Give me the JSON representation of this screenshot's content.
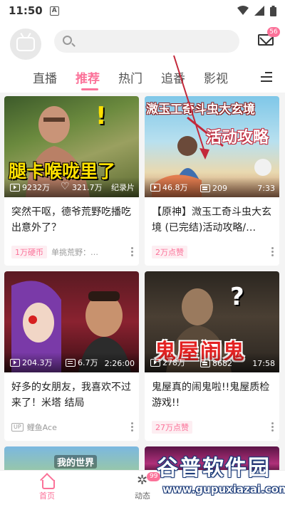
{
  "status_bar": {
    "time": "11:50",
    "a_icon_label": "A"
  },
  "header": {
    "search_placeholder": "",
    "mail_badge": "56"
  },
  "tabs": [
    {
      "label": "直播",
      "active": false
    },
    {
      "label": "推荐",
      "active": true
    },
    {
      "label": "热门",
      "active": false
    },
    {
      "label": "追番",
      "active": false
    },
    {
      "label": "影视",
      "active": false
    }
  ],
  "cards": [
    {
      "thumb_text": "腿卡喉咙里了",
      "thumb_mark": "!",
      "views": "9232万",
      "likes": "321.7万",
      "right_label": "纪录片",
      "title": "突然干呕，德爷荒野吃播吃出意外了？",
      "pill": "1万硬币",
      "author": "单挑荒野：…"
    },
    {
      "thumb_text_1": "溦玉工奇斗虫大玄境",
      "thumb_text_2": "活动攻略",
      "views": "46.8万",
      "danmaku": "209",
      "right_label": "7:33",
      "title": "【原神】溦玉工奇斗虫大玄境 (已完结)活动攻略/…",
      "pill": "2万点赞"
    },
    {
      "views": "204.3万",
      "danmaku": "6.7万",
      "right_label": "2:26:00",
      "title": "好多的女朋友，我喜欢不过来了！米塔 结局",
      "up_tag": "UP",
      "author": "鲤鱼Ace"
    },
    {
      "thumb_text": "鬼屋闹鬼",
      "thumb_mark": "?",
      "views": "278万",
      "danmaku": "8682",
      "right_label": "17:58",
      "title": "鬼屋真的闹鬼啦!!鬼屋质检游戏!!",
      "pill": "27万点赞"
    },
    {
      "thumb_text": "我的世界"
    }
  ],
  "bottom_nav": {
    "home": "首页",
    "dynamic": "动态",
    "dynamic_badge": "99"
  },
  "watermark": {
    "main": "谷普软件园",
    "url": "www.gupuxiazai.com"
  },
  "colors": {
    "accent": "#fb7299",
    "background": "#f4f4f4"
  }
}
